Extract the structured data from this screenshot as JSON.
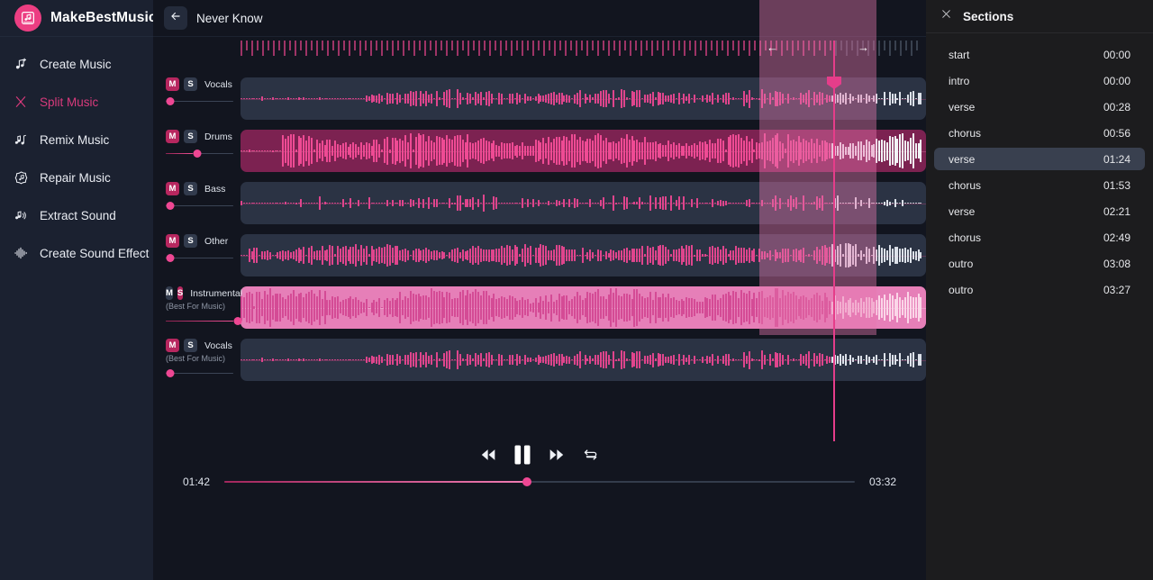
{
  "brand": {
    "name": "MakeBestMusic",
    "logo_icon": "music-mixer-icon",
    "accent": "#ec3e82"
  },
  "sidebar": {
    "items": [
      {
        "label": "Create Music",
        "icon": "music-note-plus-icon",
        "active": false
      },
      {
        "label": "Split Music",
        "icon": "split-fork-icon",
        "active": true
      },
      {
        "label": "Remix Music",
        "icon": "double-note-icon",
        "active": false
      },
      {
        "label": "Repair Music",
        "icon": "gear-note-icon",
        "active": false
      },
      {
        "label": "Extract Sound",
        "icon": "note-speaker-icon",
        "active": false
      },
      {
        "label": "Create Sound Effect",
        "icon": "waveform-icon",
        "active": false
      }
    ]
  },
  "topbar": {
    "back_icon": "arrow-left-icon",
    "title": "Never Know"
  },
  "tracks": [
    {
      "name": "Vocals",
      "sub": "",
      "mute_on": true,
      "solo_on": false,
      "volume": 0,
      "style": "normal"
    },
    {
      "name": "Drums",
      "sub": "",
      "mute_on": true,
      "solo_on": false,
      "volume": 40,
      "style": "highlight"
    },
    {
      "name": "Bass",
      "sub": "",
      "mute_on": true,
      "solo_on": false,
      "volume": 0,
      "style": "normal"
    },
    {
      "name": "Other",
      "sub": "",
      "mute_on": true,
      "solo_on": false,
      "volume": 0,
      "style": "normal"
    },
    {
      "name": "Instrumental",
      "sub": "(Best For Music)",
      "mute_on": false,
      "solo_on": true,
      "volume": 100,
      "style": "selected"
    },
    {
      "name": "Vocals",
      "sub": "(Best For Music)",
      "mute_on": true,
      "solo_on": false,
      "volume": 0,
      "style": "normal"
    }
  ],
  "labels": {
    "mute": "M",
    "solo": "S"
  },
  "selection": {
    "left_handle_icon": "arrow-left-icon",
    "right_handle_icon": "arrow-right-icon"
  },
  "transport": {
    "rewind_icon": "rewind-icon",
    "pause_icon": "pause-icon",
    "forward_icon": "fast-forward-icon",
    "loop_icon": "loop-icon",
    "current_time": "01:42",
    "total_time": "03:32",
    "progress_pct": 48
  },
  "sections_panel": {
    "close_icon": "close-icon",
    "title": "Sections",
    "items": [
      {
        "label": "start",
        "time": "00:00",
        "active": false
      },
      {
        "label": "intro",
        "time": "00:00",
        "active": false
      },
      {
        "label": "verse",
        "time": "00:28",
        "active": false
      },
      {
        "label": "chorus",
        "time": "00:56",
        "active": false
      },
      {
        "label": "verse",
        "time": "01:24",
        "active": true
      },
      {
        "label": "chorus",
        "time": "01:53",
        "active": false
      },
      {
        "label": "verse",
        "time": "02:21",
        "active": false
      },
      {
        "label": "chorus",
        "time": "02:49",
        "active": false
      },
      {
        "label": "outro",
        "time": "03:08",
        "active": false
      },
      {
        "label": "outro",
        "time": "03:27",
        "active": false
      }
    ]
  }
}
